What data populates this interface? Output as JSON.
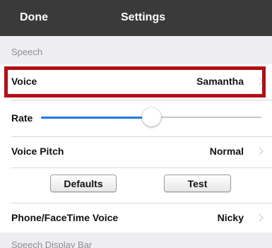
{
  "navbar": {
    "done_label": "Done",
    "title": "Settings"
  },
  "sections": {
    "speech_header": "Speech",
    "speech_display_header": "Speech Display Bar"
  },
  "rows": {
    "voice": {
      "label": "Voice",
      "value": "Samantha"
    },
    "rate": {
      "label": "Rate",
      "slider_level": 0.5
    },
    "voice_pitch": {
      "label": "Voice Pitch",
      "value": "Normal"
    },
    "phone_facetime_voice": {
      "label": "Phone/FaceTime Voice",
      "value": "Nicky"
    }
  },
  "buttons": {
    "defaults_label": "Defaults",
    "test_label": "Test"
  },
  "colors": {
    "navbar_bg": "#3a3a3a",
    "highlight": "#b30f16",
    "slider_accent": "#1f7ae0"
  },
  "icons": [
    "chevron-right-icon"
  ]
}
